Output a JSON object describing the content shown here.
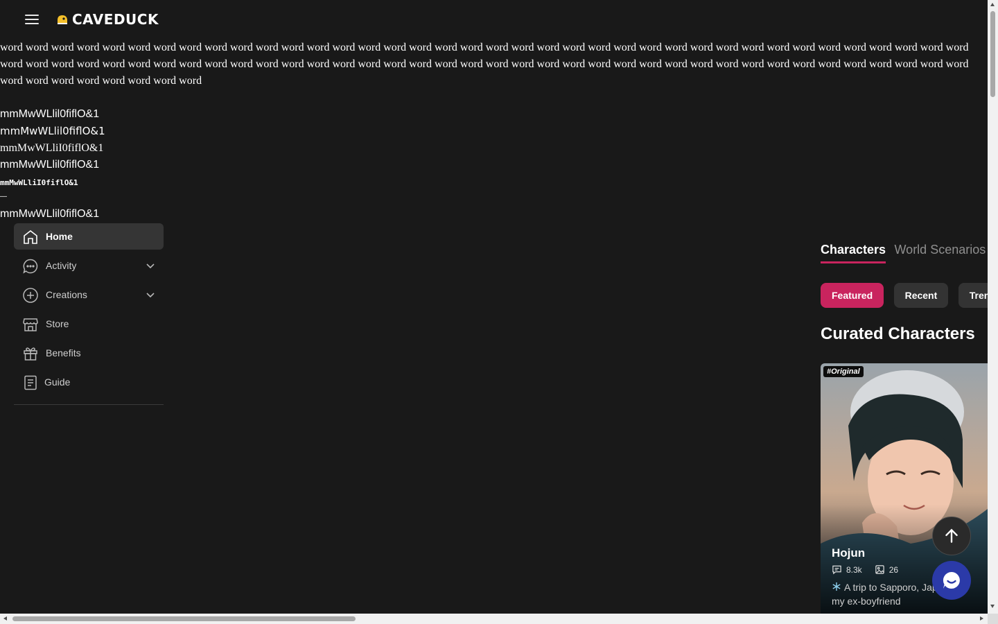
{
  "app": {
    "logo_text": "CAVEDUCK"
  },
  "test_text": {
    "words": "word word word word word word word word word word word word word word word word word word word word word word word word word word word word word word word word word word word word word word word word word word word word word word word word word word word word word word word word word word word word word word word word word word word word word word word word word word word word word word word word word word word word",
    "samples": [
      "mmMwWLlil0fiflO&1",
      "mmMwWLlil0fiflO&1",
      "mmMwWLliI0fiflO&1",
      "mmMwWLlil0fiflO&1",
      "mmMwWLliI0fiflO&1",
      "—",
      "mmMwWLlil0fiflO&1"
    ]
  },
  "sidebar": {
    "items": [
      {
        "label": "Home",
        "icon": "home-icon",
        "active": true
      },
      {
        "label": "Activity",
        "icon": "chat-bubble-icon",
        "expandable": true
      },
      {
        "label": "Creations",
        "icon": "plus-circle-icon",
        "expandable": true
      },
      {
        "label": "Store",
        "icon": "store-icon"
      },
      {
        "label": "Benefits",
        "icon": "gift-icon"
      },
      {
        "label": "Guide",
        "icon": "book-icon"
      }
    ]
  },
  "main": {
    "tabs": [
      {
        "label": "Characters",
        "active": true
      },
      {
        "label": "World Scenarios",
        "active": false
      }
    ],
    "filters": [
      {
        "label": "Featured",
        "active": true
      },
      {
        "label": "Recent",
        "active": false
      },
      {
        "label": "Trending",
        "active": false
      }
    ],
    "section_title": "Curated Characters",
    "card": {
      "badge": "#Original",
      "name": "Hojun",
      "messages": "8.3k",
      "images": "26",
      "description": "A trip to Sapporo, Japan with my ex-boyfriend"
    }
  },
  "colors": {
    "accent": "#c9245e",
    "background": "#191919",
    "chat_fab": "#2b3aa8"
  }
}
